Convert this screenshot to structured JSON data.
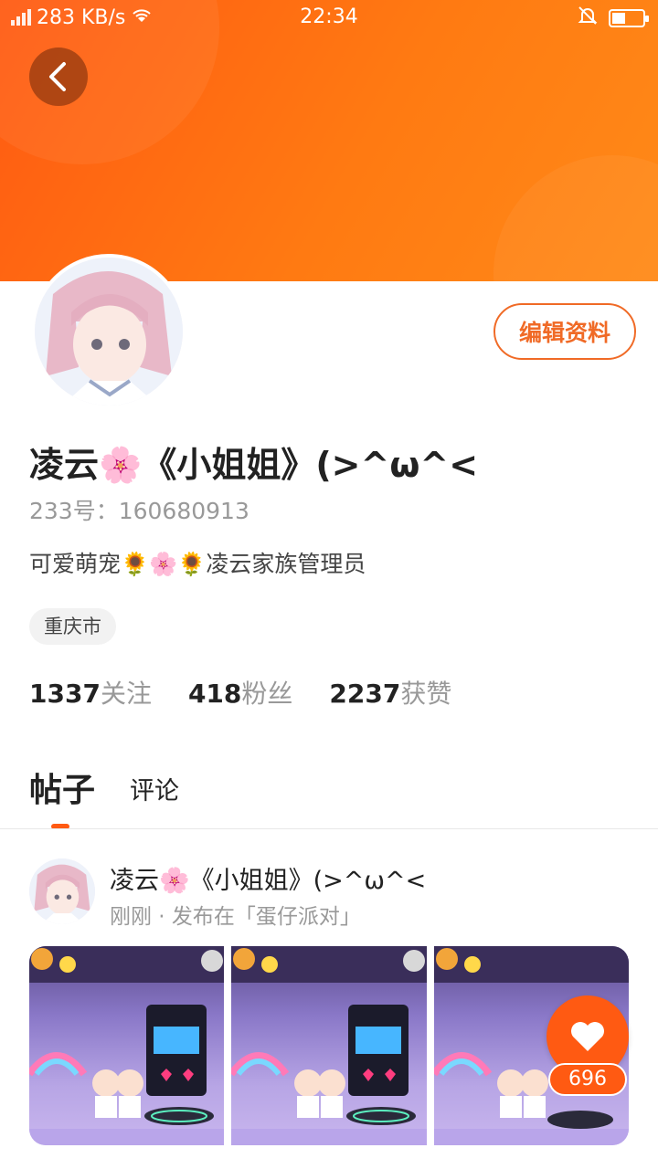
{
  "status_bar": {
    "speed": "283 KB/s",
    "time": "22:34"
  },
  "profile": {
    "name": "凌云🌸《小姐姐》(>^ω^<",
    "uid": "233号：160680913",
    "bio": "可爱萌宠🌻🌸🌻凌云家族管理员",
    "location": "重庆市",
    "edit_label": "编辑资料",
    "stats": [
      {
        "count": "1337",
        "label": "关注"
      },
      {
        "count": "418",
        "label": "粉丝"
      },
      {
        "count": "2237",
        "label": "获赞"
      }
    ]
  },
  "tabs": {
    "posts": "帖子",
    "comments": "评论"
  },
  "post": {
    "author": "凌云🌸《小姐姐》(>^ω^<",
    "meta": "刚刚 · 发布在「蛋仔派对」",
    "likes": "696"
  },
  "colors": {
    "accent": "#ff5a12",
    "edit_border": "#f06a26"
  },
  "icons": {
    "back": "chevron-left-icon",
    "like": "heart-icon"
  }
}
